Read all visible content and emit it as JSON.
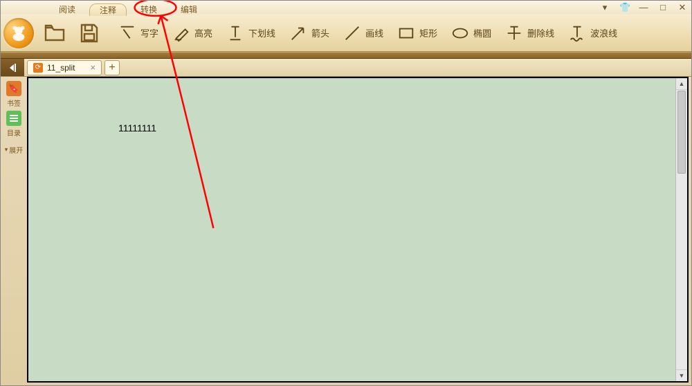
{
  "menu": {
    "tabs": [
      "阅读",
      "注释",
      "转换",
      "编辑"
    ],
    "active_index": 1,
    "highlighted_index": 2
  },
  "window_controls": {
    "dropdown": "▾",
    "shirt": "👕",
    "minimize": "—",
    "maximize": "□",
    "close": "✕"
  },
  "toolbar": {
    "items": [
      {
        "name": "write",
        "label": "写字"
      },
      {
        "name": "highlight",
        "label": "高亮"
      },
      {
        "name": "underline",
        "label": "下划线"
      },
      {
        "name": "arrow",
        "label": "箭头"
      },
      {
        "name": "line",
        "label": "画线"
      },
      {
        "name": "rect",
        "label": "矩形"
      },
      {
        "name": "ellipse",
        "label": "椭圆"
      },
      {
        "name": "strike",
        "label": "删除线"
      },
      {
        "name": "wave",
        "label": "波浪线"
      }
    ]
  },
  "file_tabs": {
    "items": [
      {
        "title": "11_split"
      }
    ]
  },
  "sidebar": {
    "bookmark": "书签",
    "toc": "目录",
    "expand": "展开"
  },
  "document": {
    "content": "11111111"
  },
  "annotation": {
    "circle_tab_index": 2
  }
}
